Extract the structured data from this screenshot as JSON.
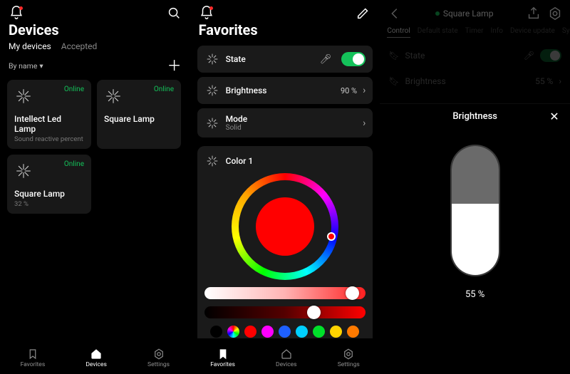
{
  "screen1": {
    "title": "Devices",
    "tabs": [
      "My devices",
      "Accepted"
    ],
    "activeTab": 0,
    "sortLabel": "By name",
    "devices": [
      {
        "name": "Intellect Led Lamp",
        "subtitle": "Sound reactive percent",
        "status": "Online"
      },
      {
        "name": "Square Lamp",
        "subtitle": "",
        "status": "Online"
      },
      {
        "name": "Square Lamp",
        "subtitle": "32  %",
        "status": "Online"
      }
    ],
    "nav": {
      "favorites": "Favorites",
      "devices": "Devices",
      "settings": "Settings",
      "active": "devices"
    }
  },
  "screen2": {
    "title": "Favorites",
    "rows": {
      "state": {
        "label": "State",
        "on": true
      },
      "brightness": {
        "label": "Brightness",
        "value": "90 %"
      },
      "mode": {
        "label": "Mode",
        "value": "Solid"
      },
      "color": {
        "label": "Color 1"
      }
    },
    "swatches": [
      "#000000",
      "rainbow",
      "#ff0000",
      "#ff00ff",
      "#1e60ff",
      "#00d0ff",
      "#00e02a",
      "#ffd400",
      "#ff7a00"
    ],
    "slider1_knob_pct": 92,
    "slider2_knob_pct": 68,
    "nav": {
      "favorites": "Favorites",
      "devices": "Devices",
      "settings": "Settings",
      "active": "favorites"
    }
  },
  "screen3": {
    "deviceName": "Square Lamp",
    "tabs": [
      "Control",
      "Default state",
      "Timer",
      "Info",
      "Device update",
      "Sync"
    ],
    "activeTab": 0,
    "behind": {
      "state": {
        "label": "State",
        "on": true
      },
      "brightness": {
        "label": "Brightness",
        "value": "55 %"
      }
    },
    "sheet": {
      "title": "Brightness",
      "percent": 55,
      "valueText": "55  %"
    }
  }
}
